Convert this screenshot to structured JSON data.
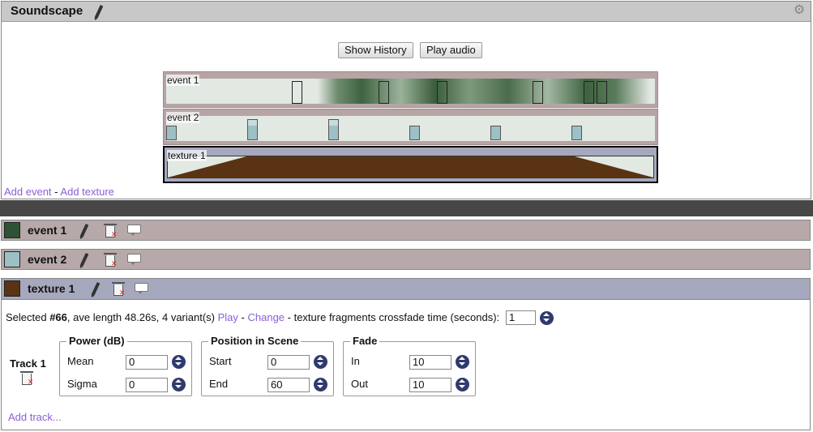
{
  "soundscape": {
    "title": "Soundscape",
    "show_history_label": "Show History",
    "play_audio_label": "Play audio",
    "tracks": [
      {
        "label": "event 1",
        "color": "#2e5233"
      },
      {
        "label": "event 2",
        "color": "#9cc0c4"
      },
      {
        "label": "texture 1",
        "color": "#5a3412"
      }
    ],
    "add_event_label": "Add event",
    "separator": "-",
    "add_texture_label": "Add texture"
  },
  "items": [
    {
      "title": "event 1",
      "color": "#2e5233"
    },
    {
      "title": "event 2",
      "color": "#9cc0c4"
    },
    {
      "title": "texture 1",
      "color": "#5a3412"
    }
  ],
  "texture": {
    "selected_prefix": "Selected ",
    "selected_id": "#66",
    "selected_info": ", ave length 48.26s, 4 variant(s) ",
    "play_label": "Play",
    "sep": " - ",
    "change_label": "Change",
    "crossfade_text": " - texture fragments crossfade time (seconds):",
    "crossfade_value": "1",
    "track_label": "Track 1",
    "power": {
      "legend": "Power (dB)",
      "mean_label": "Mean",
      "mean_value": "0",
      "sigma_label": "Sigma",
      "sigma_value": "0"
    },
    "position": {
      "legend": "Position in Scene",
      "start_label": "Start",
      "start_value": "0",
      "end_label": "End",
      "end_value": "60"
    },
    "fade": {
      "legend": "Fade",
      "in_label": "In",
      "in_value": "10",
      "out_label": "Out",
      "out_value": "10"
    },
    "add_track_label": "Add track..."
  }
}
